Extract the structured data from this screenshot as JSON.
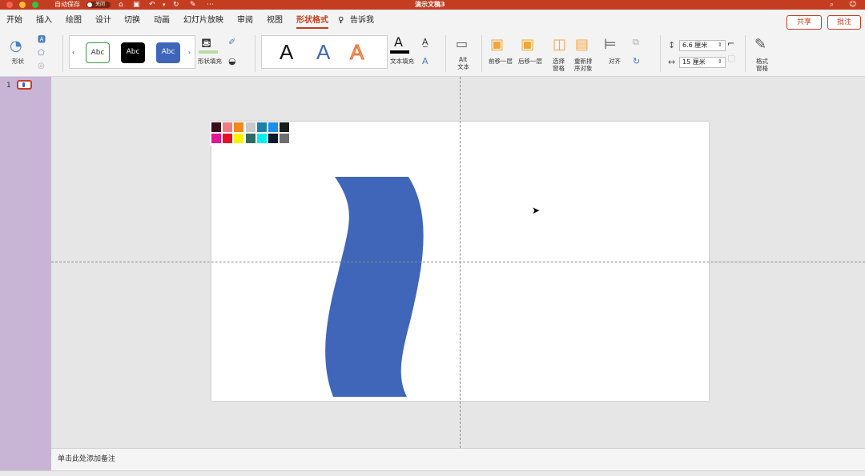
{
  "titlebar": {
    "autosave_label": "自动保存",
    "autosave_state": "关闭",
    "document_title": "演示文稿3"
  },
  "menu": {
    "tabs": [
      "开始",
      "插入",
      "绘图",
      "设计",
      "切换",
      "动画",
      "幻灯片放映",
      "审阅",
      "视图",
      "形状格式"
    ],
    "tell_me": "告诉我",
    "share": "共享",
    "comments": "批注"
  },
  "ribbon": {
    "shape_label": "形状",
    "style_samples": [
      "Abc",
      "Abc",
      "Abc"
    ],
    "shape_fill_label": "形状填充",
    "wordart_samples": [
      "A",
      "A",
      "A"
    ],
    "text_fill_label": "文本填充",
    "alt_text_label_1": "Alt",
    "alt_text_label_2": "文本",
    "bring_forward": "前移一层",
    "send_backward": "后移一层",
    "selection_pane_1": "选择",
    "selection_pane_2": "窗格",
    "reorder_1": "重新排",
    "reorder_2": "序对象",
    "align": "对齐",
    "height_value": "6.6 厘米",
    "width_value": "15 厘米",
    "format_pane_1": "格式",
    "format_pane_2": "窗格"
  },
  "slides_panel": {
    "slide_number": "1"
  },
  "notes": {
    "placeholder": "单击此处添加备注"
  },
  "colors": {
    "accent": "#c43d20",
    "shape_fill": "#3f66b8"
  },
  "palette": [
    "#3a0d1a",
    "#f07b84",
    "#f08a1d",
    "#c9c9c9",
    "#1b7fa6",
    "#1c8ee6",
    "#1a1a1a",
    "#e01895",
    "#e81123",
    "#fff200",
    "#2e6b62",
    "#00f0f0",
    "#0c1a2e",
    "#6e6e6e"
  ]
}
